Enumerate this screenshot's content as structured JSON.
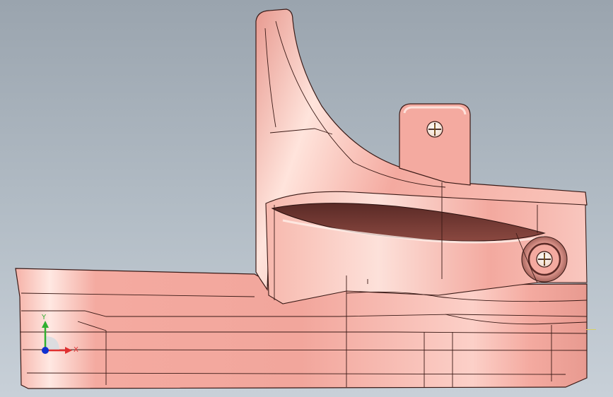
{
  "viewport": {
    "background_top": "#9aa4ae",
    "background_bottom": "#c8d0d8"
  },
  "part": {
    "fill_color": "#f4aaa0",
    "highlight_color": "#fff2ef",
    "shadow_color": "#c9877e",
    "edge_color": "#3a1a16",
    "cavity_color": "#6a3530"
  },
  "fasteners": [
    {
      "name": "upper-tab-screw"
    },
    {
      "name": "side-boss-screw"
    }
  ],
  "triad": {
    "x_label": "X",
    "y_label": "Y",
    "x_color": "#e03030",
    "y_color": "#30b030",
    "z_color": "#1030d0"
  },
  "reference_mark_color": "#d8d060"
}
